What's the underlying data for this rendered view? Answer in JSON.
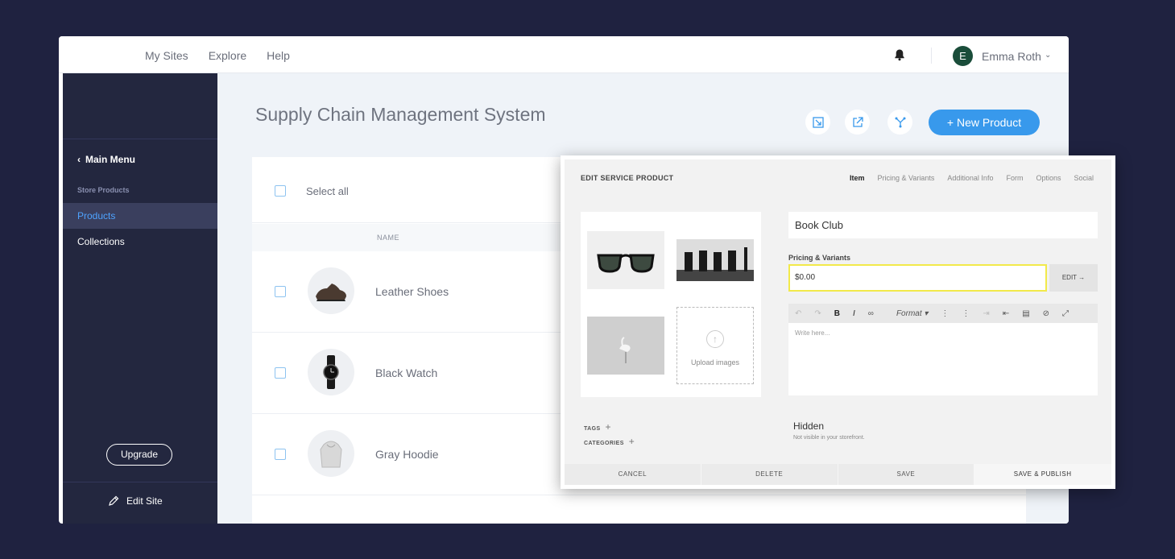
{
  "topbar": {
    "nav": [
      "My Sites",
      "Explore",
      "Help"
    ],
    "user_initial": "E",
    "user_name": "Emma Roth",
    "icons": [
      "bell-icon",
      "chevron-down-icon"
    ]
  },
  "sidebar": {
    "back_label": "Main Menu",
    "section_label": "Store Products",
    "items": [
      {
        "label": "Products",
        "active": true
      },
      {
        "label": "Collections",
        "active": false
      }
    ],
    "upgrade_label": "Upgrade",
    "edit_site_label": "Edit Site"
  },
  "main": {
    "title": "Supply Chain Management System",
    "new_product_label": "+ New Product",
    "select_all_label": "Select all",
    "column_name": "NAME",
    "products": [
      {
        "name": "Leather Shoes"
      },
      {
        "name": "Black Watch"
      },
      {
        "name": "Gray Hoodie"
      }
    ]
  },
  "editor": {
    "title": "EDIT SERVICE PRODUCT",
    "tabs": [
      "Item",
      "Pricing & Variants",
      "Additional Info",
      "Form",
      "Options",
      "Social"
    ],
    "active_tab": "Item",
    "upload_label": "Upload images",
    "product_name": "Book Club",
    "pricing_label": "Pricing & Variants",
    "price": "$0.00",
    "edit_label": "EDIT →",
    "format_label": "Format",
    "editor_placeholder": "Write here...",
    "tags_label": "TAGS",
    "categories_label": "CATEGORIES",
    "visibility_title": "Hidden",
    "visibility_subtitle": "Not visible in your storefront.",
    "footer": [
      "CANCEL",
      "DELETE",
      "SAVE",
      "SAVE & PUBLISH"
    ]
  },
  "colors": {
    "background": "#1f2240",
    "sidebar": "#23273f",
    "accent": "#3899ec",
    "active_link": "#4ea3ff",
    "price_highlight": "#f2e94a"
  }
}
